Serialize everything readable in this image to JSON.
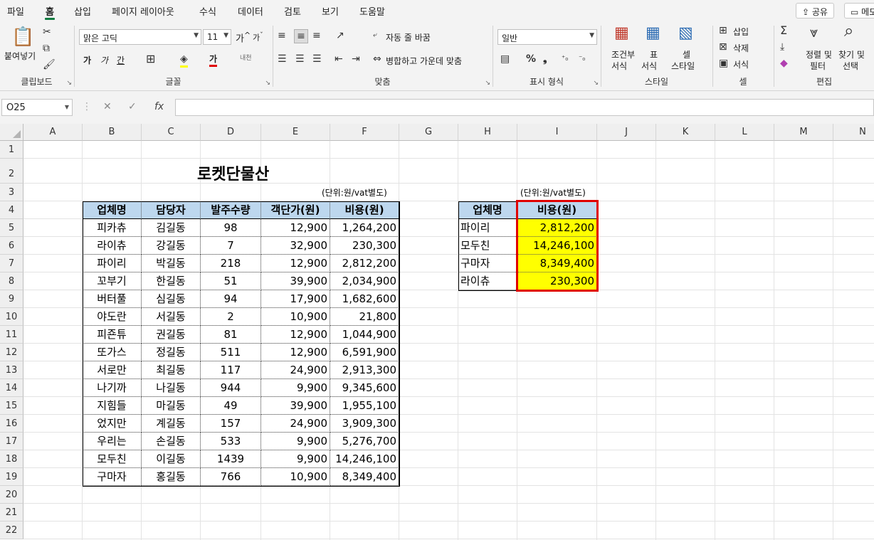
{
  "tabs": [
    "파일",
    "홈",
    "삽입",
    "페이지 레이아웃",
    "수식",
    "데이터",
    "검토",
    "보기",
    "도움말"
  ],
  "active_tab": "홈",
  "share_label": "공유",
  "memo_label": "메모",
  "ribbon": {
    "clipboard": {
      "paste": "붙여넣기",
      "label": "클립보드"
    },
    "font": {
      "name": "맑은 고딕",
      "size": "11",
      "grow": "가",
      "shrink": "가",
      "bold": "가",
      "italic": "가",
      "underline": "간",
      "phonetic": "내천",
      "label": "글꼴"
    },
    "alignment": {
      "wrap": "자동 줄 바꿈",
      "merge": "병합하고 가운데 맞춤",
      "label": "맞춤"
    },
    "number": {
      "format": "일반",
      "label": "표시 형식"
    },
    "styles": {
      "conditional_1": "조건부",
      "conditional_2": "서식",
      "table_1": "표",
      "table_2": "서식",
      "cell_1": "셀",
      "cell_2": "스타일",
      "label": "스타일"
    },
    "cells": {
      "insert": "삽입",
      "delete": "삭제",
      "format": "서식",
      "label": "셀"
    },
    "editing": {
      "sort_1": "정렬 및",
      "sort_2": "필터",
      "find_1": "찾기 및",
      "find_2": "선택",
      "label": "편집"
    }
  },
  "name_box": "O25",
  "formula": "",
  "columns": [
    "A",
    "B",
    "C",
    "D",
    "E",
    "F",
    "G",
    "H",
    "I",
    "J",
    "K",
    "L",
    "M",
    "N"
  ],
  "rows": [
    "1",
    "2",
    "3",
    "4",
    "5",
    "6",
    "7",
    "8",
    "9",
    "10",
    "11",
    "12",
    "13",
    "14",
    "15",
    "16",
    "17",
    "18",
    "19",
    "20",
    "21",
    "22"
  ],
  "sheet": {
    "title": "로켓단물산",
    "unit_note": "(단위:원/vat별도)",
    "main_table": {
      "headers": [
        "업체명",
        "담당자",
        "발주수량",
        "객단가(원)",
        "비용(원)"
      ],
      "rows": [
        [
          "피카츄",
          "김길동",
          "98",
          "12,900",
          "1,264,200"
        ],
        [
          "라이츄",
          "강길동",
          "7",
          "32,900",
          "230,300"
        ],
        [
          "파이리",
          "박길동",
          "218",
          "12,900",
          "2,812,200"
        ],
        [
          "꼬부기",
          "한길동",
          "51",
          "39,900",
          "2,034,900"
        ],
        [
          "버터풀",
          "심길동",
          "94",
          "17,900",
          "1,682,600"
        ],
        [
          "야도란",
          "서길동",
          "2",
          "10,900",
          "21,800"
        ],
        [
          "피죤튜",
          "권길동",
          "81",
          "12,900",
          "1,044,900"
        ],
        [
          "또가스",
          "정길동",
          "511",
          "12,900",
          "6,591,900"
        ],
        [
          "서로만",
          "최길동",
          "117",
          "24,900",
          "2,913,300"
        ],
        [
          "나기까",
          "나길동",
          "944",
          "9,900",
          "9,345,600"
        ],
        [
          "지힘들",
          "마길동",
          "49",
          "39,900",
          "1,955,100"
        ],
        [
          "었지만",
          "계길동",
          "157",
          "24,900",
          "3,909,300"
        ],
        [
          "우리는",
          "손길동",
          "533",
          "9,900",
          "5,276,700"
        ],
        [
          "모두친",
          "이길동",
          "1439",
          "9,900",
          "14,246,100"
        ],
        [
          "구마자",
          "홍길동",
          "766",
          "10,900",
          "8,349,400"
        ]
      ]
    },
    "lookup_table": {
      "unit_note": "(단위:원/vat별도)",
      "headers": [
        "업체명",
        "비용(원)"
      ],
      "rows": [
        [
          "파이리",
          "2,812,200"
        ],
        [
          "모두친",
          "14,246,100"
        ],
        [
          "구마자",
          "8,349,400"
        ],
        [
          "라이츄",
          "230,300"
        ]
      ]
    }
  },
  "colors": {
    "header_fill": "#bdd7ee",
    "highlight_fill": "#ffff00",
    "selection_border": "#e00000",
    "accent": "#107c41"
  }
}
